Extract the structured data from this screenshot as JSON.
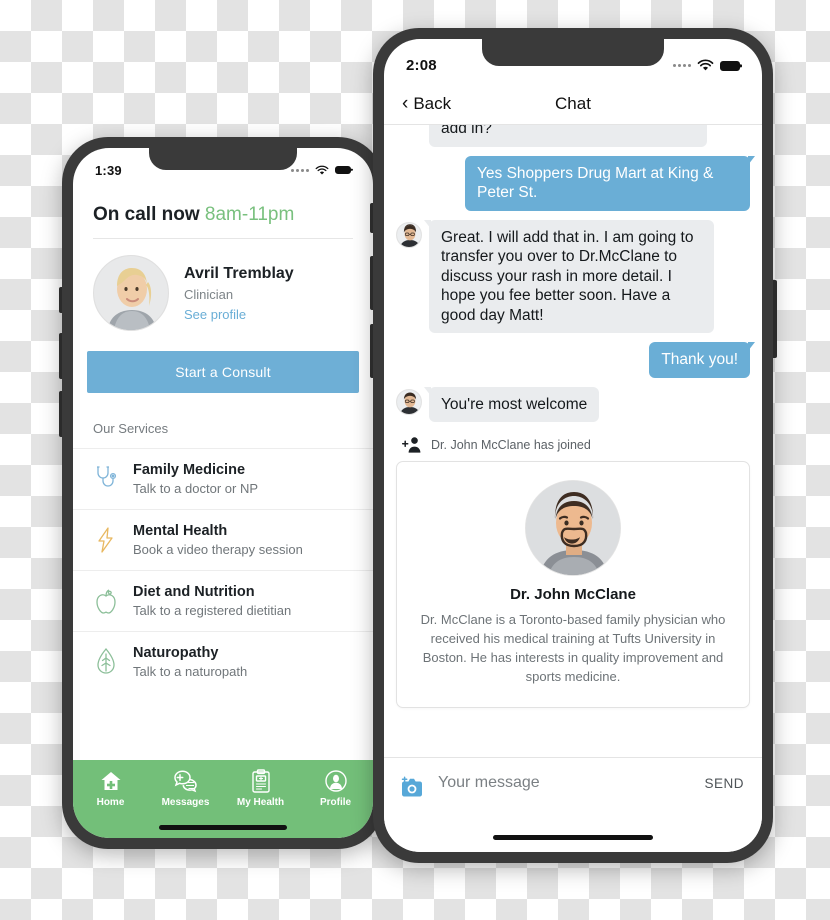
{
  "background": {
    "checker_light": "#ffffff",
    "checker_dark": "#e3e3e3"
  },
  "theme": {
    "accent_blue": "#6aaed6",
    "accent_green": "#73bf79",
    "frame_dark": "#3a3a3a",
    "bubble_in_gray": "#eaecee"
  },
  "left_phone": {
    "status": {
      "time": "1:39",
      "wifi_icon": "wifi-icon",
      "battery_icon": "battery-icon",
      "signal_icon": "signal-dots-icon"
    },
    "header": {
      "title": "On call now",
      "hours": "8am-11pm"
    },
    "clinician": {
      "avatar": "clinician-avatar",
      "name": "Avril Tremblay",
      "role": "Clinician",
      "profile_link": "See profile"
    },
    "consult_button": "Start a Consult",
    "services_title": "Our Services",
    "services": [
      {
        "icon": "stethoscope-icon",
        "name": "Family Medicine",
        "subtitle": "Talk to a doctor or NP"
      },
      {
        "icon": "lightning-bolt-icon",
        "name": "Mental Health",
        "subtitle": "Book a video therapy session"
      },
      {
        "icon": "apple-icon",
        "name": "Diet and Nutrition",
        "subtitle": "Talk to a registered dietitian"
      },
      {
        "icon": "leaf-icon",
        "name": "Naturopathy",
        "subtitle": "Talk to a naturopath"
      }
    ],
    "tabs": [
      {
        "icon": "home-plus-icon",
        "label": "Home"
      },
      {
        "icon": "messages-icon",
        "label": "Messages"
      },
      {
        "icon": "clipboard-health-icon",
        "label": "My Health"
      },
      {
        "icon": "profile-icon",
        "label": "Profile"
      }
    ]
  },
  "right_phone": {
    "status": {
      "time": "2:08",
      "wifi_icon": "wifi-icon",
      "battery_icon": "battery-icon",
      "signal_icon": "signal-dots-icon"
    },
    "nav": {
      "back_label": "Back",
      "back_icon": "chevron-left-icon",
      "title": "Chat"
    },
    "messages": [
      {
        "side": "in",
        "text": "add in?",
        "clipped": true,
        "avatar": false
      },
      {
        "side": "out",
        "text": "Yes Shoppers Drug Mart at King & Peter St."
      },
      {
        "side": "in",
        "text": "Great. I will add that in. I am going to transfer you over to Dr.McClane to discuss your rash in more detail. I hope you fee better soon. Have a good day Matt!",
        "avatar": true
      },
      {
        "side": "out",
        "text": "Thank you!"
      },
      {
        "side": "in",
        "text": "You're most welcome",
        "avatar": true
      }
    ],
    "join_notice": {
      "icon": "person-add-icon",
      "text": "Dr. John McClane has joined"
    },
    "doctor_card": {
      "photo": "doctor-photo",
      "name": "Dr. John McClane",
      "bio": "Dr. McClane is a Toronto-based family physician who received his medical training at Tufts University in Boston. He has interests in quality improvement and sports medicine."
    },
    "composer": {
      "camera_icon": "camera-add-icon",
      "placeholder": "Your message",
      "send_label": "SEND"
    }
  }
}
